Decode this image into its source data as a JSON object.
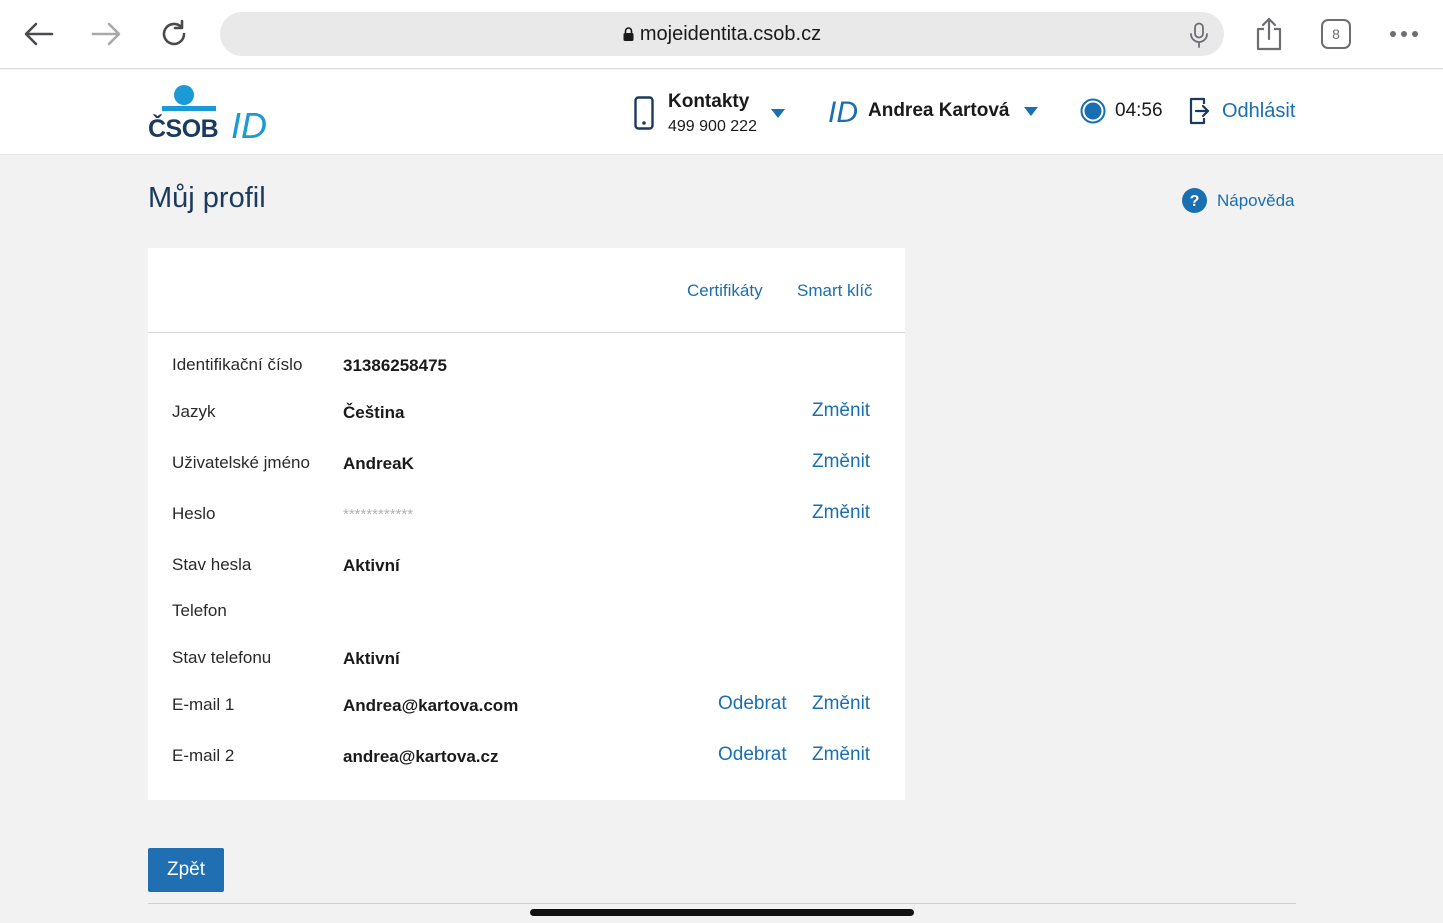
{
  "browser": {
    "url": "mojeidentita.csob.cz",
    "tab_count": "8"
  },
  "header": {
    "logo_text": "ČSOB ID",
    "contacts": {
      "label": "Kontakty",
      "phone": "499 900 222"
    },
    "user": {
      "name": "Andrea Kartová"
    },
    "timer": "04:56",
    "logout": "Odhlásit"
  },
  "page": {
    "title": "Můj profil",
    "help": "Nápověda"
  },
  "card": {
    "tabs": [
      "Certifikáty",
      "Smart klíč"
    ],
    "rows": [
      {
        "label": "Identifikační číslo",
        "value": "31386258475"
      },
      {
        "label": "Jazyk",
        "value": "Čeština",
        "change": "Změnit"
      },
      {
        "label": "Uživatelské jméno",
        "value": "AndreaK",
        "change": "Změnit"
      },
      {
        "label": "Heslo",
        "value": "************",
        "change": "Změnit"
      },
      {
        "label": "Stav hesla",
        "value": "Aktivní"
      },
      {
        "label": "Telefon",
        "value": ""
      },
      {
        "label": "Stav telefonu",
        "value": "Aktivní"
      },
      {
        "label": "E-mail 1",
        "value": "Andrea@kartova.com",
        "remove": "Odebrat",
        "change": "Změnit"
      },
      {
        "label": "E-mail 2",
        "value": "andrea@kartova.cz",
        "remove": "Odebrat",
        "change": "Změnit"
      }
    ]
  },
  "actions": {
    "back": "Zpět"
  },
  "colors": {
    "accent": "#1a6fb0",
    "brand_dark": "#1b3a5c",
    "button": "#1f6fb2"
  }
}
